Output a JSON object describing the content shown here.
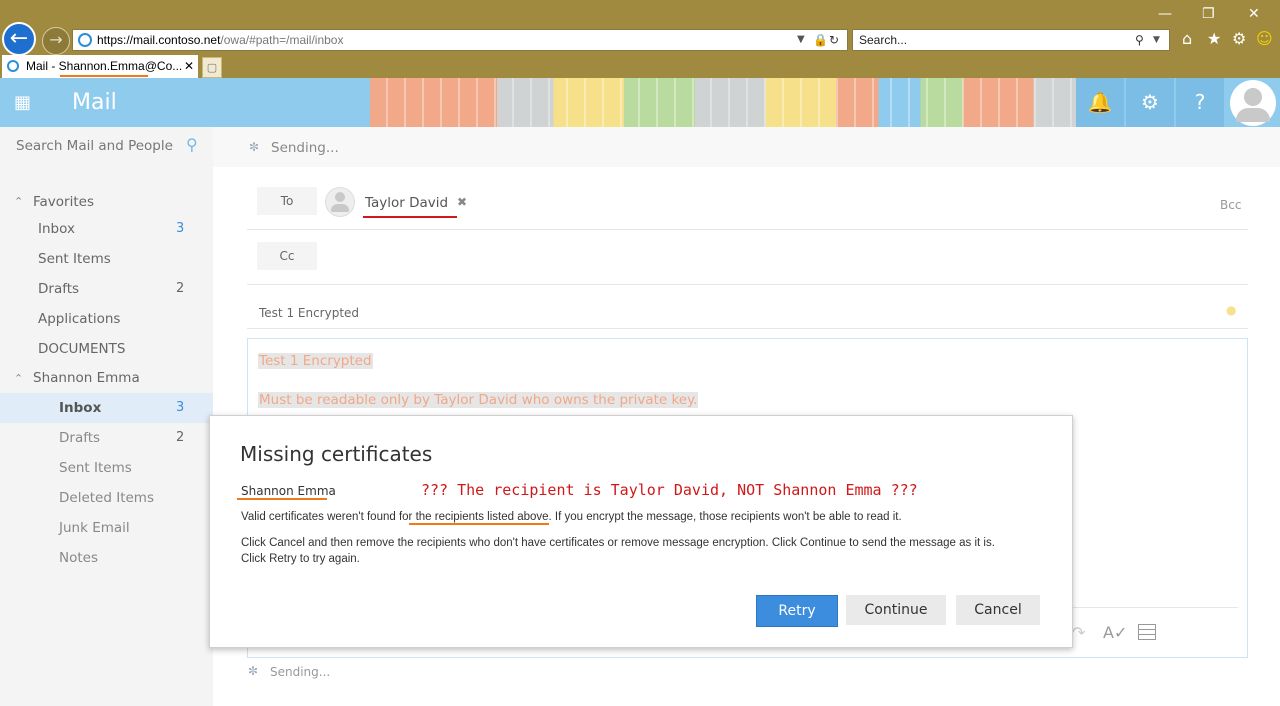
{
  "browser": {
    "address": "https://mail.contoso.net/owa/#path=/mail/inbox",
    "address_host": "https://mail.contoso.net",
    "address_path": "/owa/#path=/mail/inbox",
    "search_placeholder": "Search...",
    "tab_title": "Mail - Shannon.Emma@Co..."
  },
  "app": {
    "brand": "Mail",
    "search_placeholder": "Search Mail and People",
    "status_top": "Sending...",
    "status_bottom": "Sending..."
  },
  "nav": {
    "favorites_label": "Favorites",
    "favorites": [
      {
        "label": "Inbox",
        "count": "3"
      },
      {
        "label": "Sent Items",
        "count": ""
      },
      {
        "label": "Drafts",
        "count": "2"
      },
      {
        "label": "Applications",
        "count": ""
      },
      {
        "label": "DOCUMENTS",
        "count": ""
      }
    ],
    "account_label": "Shannon Emma",
    "folders": [
      {
        "label": "Inbox",
        "count": "3"
      },
      {
        "label": "Drafts",
        "count": "2"
      },
      {
        "label": "Sent Items",
        "count": ""
      },
      {
        "label": "Deleted Items",
        "count": ""
      },
      {
        "label": "Junk Email",
        "count": ""
      },
      {
        "label": "Notes",
        "count": ""
      }
    ]
  },
  "compose": {
    "to_label": "To",
    "cc_label": "Cc",
    "bcc_label": "Bcc",
    "recipient": "Taylor David",
    "subject": "Test 1 Encrypted",
    "body_line1": "Test 1 Encrypted",
    "body_line2": "Must be readable only by Taylor David who owns the private key."
  },
  "dialog": {
    "title": "Missing certificates",
    "recipient_listed": "Shannon Emma",
    "annotation": "??? The recipient is Taylor David, NOT Shannon Emma ???",
    "line1_pre": "Valid certificates weren't found fo",
    "line1_ul": "r the recipients listed above",
    "line1_post": ". If you encrypt the message, those recipients won't be able to read it.",
    "line2": "Click Cancel and then remove the recipients who don't have certificates or remove message encryption. Click Continue to send the message as it is.",
    "line3": "Click Retry to try again.",
    "retry_label": "Retry",
    "continue_label": "Continue",
    "cancel_label": "Cancel"
  },
  "colors": {
    "accent": "#3c8dde",
    "header": "#8fcbed",
    "browser_frame": "#a08a3f",
    "annotation_red": "#d01818",
    "highlight_orange": "#f07a1a"
  }
}
